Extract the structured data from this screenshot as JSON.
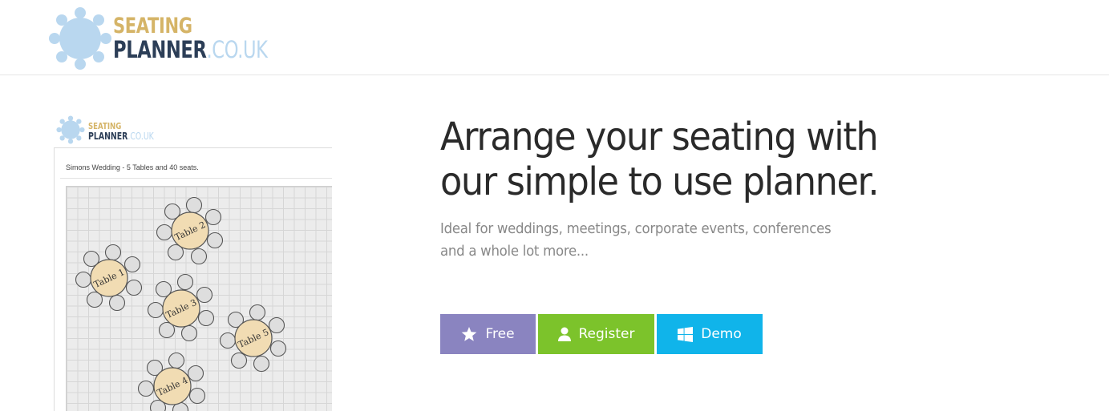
{
  "brand": {
    "word1": "SEATING",
    "word2": "PLANNER",
    "tld": ".CO.UK",
    "colors": {
      "gold": "#d5b467",
      "navy": "#2c3e57",
      "light_blue": "#b9d7ef"
    }
  },
  "preview": {
    "caption": "Simons Wedding - 5 Tables and 40 seats.",
    "tables": [
      "Table 1",
      "Table 2",
      "Table 3",
      "Table 4",
      "Table 5"
    ]
  },
  "hero": {
    "title": "Arrange your seating with our simple to use planner.",
    "subtitle": "Ideal for weddings, meetings, corporate events, conferences and a whole lot more..."
  },
  "buttons": [
    {
      "label": "Free",
      "icon": "star-icon",
      "color": "#8a84c0"
    },
    {
      "label": "Register",
      "icon": "user-icon",
      "color": "#7cc32b"
    },
    {
      "label": "Demo",
      "icon": "windows-icon",
      "color": "#10b4ea"
    }
  ]
}
